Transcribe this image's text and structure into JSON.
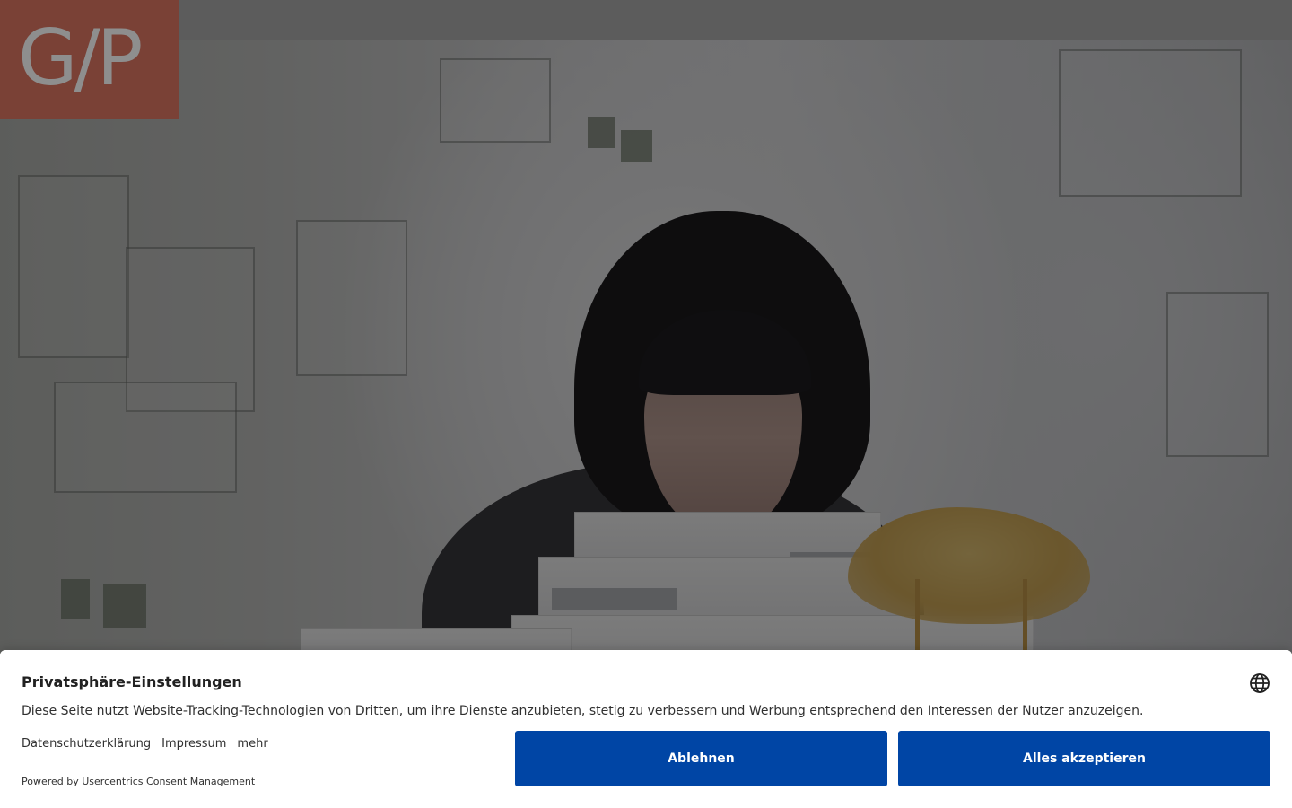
{
  "header": {
    "logo_text": "G/P"
  },
  "consent": {
    "title": "Privatsphäre-Einstellungen",
    "description": "Diese Seite nutzt Website-Tracking-Technologien von Dritten, um ihre Dienste anzubieten, stetig zu verbessern und Werbung entsprechend den Interessen der Nutzer anzuzeigen.",
    "links": [
      "Datenschutzerklärung",
      "Impressum",
      "mehr"
    ],
    "powered_by": "Powered by Usercentrics Consent Management",
    "deny_label": "Ablehnen",
    "accept_label": "Alles akzeptieren",
    "language_icon": "globe-icon"
  },
  "colors": {
    "primary_button": "#0045a5",
    "logo_background": "#7a4136",
    "overlay": "rgba(0,0,0,0.50)"
  }
}
